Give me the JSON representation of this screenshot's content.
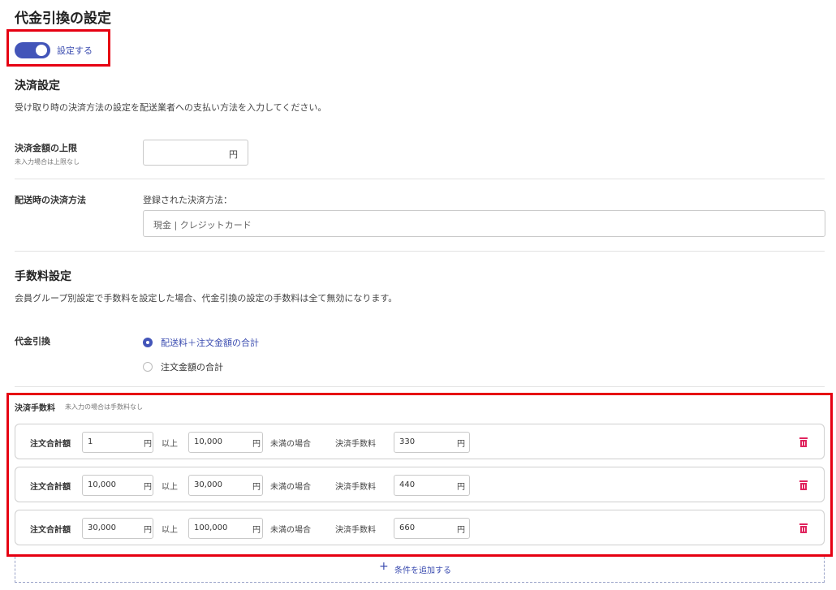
{
  "page": {
    "title": "代金引換の設定"
  },
  "toggle": {
    "label": "設定する",
    "on": true,
    "accent": "#4355b9"
  },
  "payment": {
    "heading": "決済設定",
    "description": "受け取り時の決済方法の設定を配送業者への支払い方法を入力してください。",
    "limit": {
      "label": "決済金額の上限",
      "sub": "未入力場合は上限なし",
      "value": "",
      "unit": "円"
    },
    "method": {
      "label": "配送時の決済方法",
      "caption": "登録された決済方法：",
      "value": "現金 | クレジットカード"
    }
  },
  "fee": {
    "heading": "手数料設定",
    "description": "会員グループ別設定で手数料を設定した場合、代金引換の設定の手数料は全て無効になります。",
    "cod_label": "代金引換",
    "options": [
      {
        "label": "配送料＋注文金額の合計",
        "selected": true
      },
      {
        "label": "注文金額の合計",
        "selected": false
      }
    ],
    "section_label": "決済手数料",
    "section_sub": "未入力の場合は手数料なし",
    "row_labels": {
      "total": "注文合計額",
      "yen": "円",
      "above": "以上",
      "below": "未満の場合",
      "fee": "決済手数料"
    },
    "rows": [
      {
        "from": "1",
        "to": "10,000",
        "fee": "330"
      },
      {
        "from": "10,000",
        "to": "30,000",
        "fee": "440"
      },
      {
        "from": "30,000",
        "to": "100,000",
        "fee": "660"
      }
    ],
    "add_label": "条件を追加する",
    "add_icon": "plus-icon",
    "delete_icon": "trash-icon",
    "delete_color": "#e0245e"
  }
}
